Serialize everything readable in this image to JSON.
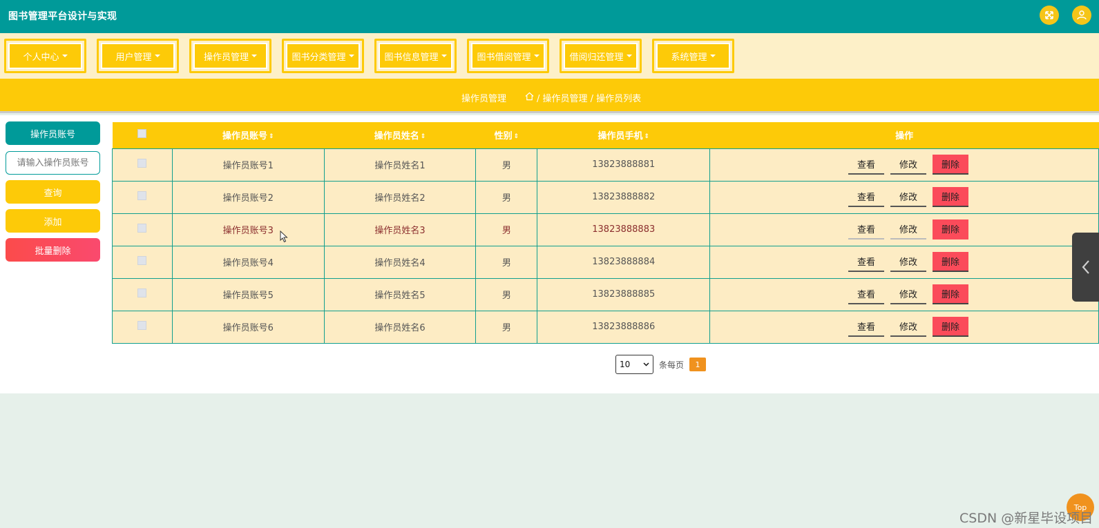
{
  "header": {
    "title": "图书管理平台设计与实现",
    "fullscreen_icon": "fullscreen-icon",
    "user_icon": "user-icon",
    "icon_color": "#f5c518"
  },
  "nav": {
    "items": [
      {
        "label": "个人中心"
      },
      {
        "label": "用户管理"
      },
      {
        "label": "操作员管理"
      },
      {
        "label": "图书分类管理"
      },
      {
        "label": "图书信息管理"
      },
      {
        "label": "图书借阅管理"
      },
      {
        "label": "借阅归还管理"
      },
      {
        "label": "系统管理"
      }
    ]
  },
  "breadcrumb": {
    "title": "操作员管理",
    "home_icon": "home-icon",
    "path": "/ 操作员管理 / 操作员列表"
  },
  "sidebar": {
    "label": "操作员账号",
    "search_placeholder": "请输入操作员账号",
    "query": "查询",
    "add": "添加",
    "batch_delete": "批量删除"
  },
  "table": {
    "headers": {
      "account": "操作员账号",
      "name": "操作员姓名",
      "gender": "性别",
      "phone": "操作员手机",
      "ops": "操作"
    },
    "rows": [
      {
        "account": "操作员账号1",
        "name": "操作员姓名1",
        "gender": "男",
        "phone": "13823888881"
      },
      {
        "account": "操作员账号2",
        "name": "操作员姓名2",
        "gender": "男",
        "phone": "13823888882"
      },
      {
        "account": "操作员账号3",
        "name": "操作员姓名3",
        "gender": "男",
        "phone": "13823888883"
      },
      {
        "account": "操作员账号4",
        "name": "操作员姓名4",
        "gender": "男",
        "phone": "13823888884"
      },
      {
        "account": "操作员账号5",
        "name": "操作员姓名5",
        "gender": "男",
        "phone": "13823888885"
      },
      {
        "account": "操作员账号6",
        "name": "操作员姓名6",
        "gender": "男",
        "phone": "13823888886"
      }
    ],
    "actions": {
      "view": "查看",
      "edit": "修改",
      "delete": "删除"
    }
  },
  "pagination": {
    "page_size": "10",
    "per_page_label": "条每页",
    "current_page": "1"
  },
  "top_button": "Top",
  "watermark": "CSDN @新星毕设项目",
  "colors": {
    "header": "#009a99",
    "accent": "#fdca08",
    "delete": "#fb4b5a",
    "page": "#f0921e"
  }
}
